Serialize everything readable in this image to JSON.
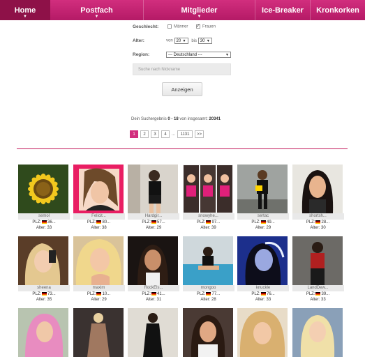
{
  "nav": {
    "items": [
      {
        "label": "Home",
        "caret": "▼"
      },
      {
        "label": "Postfach",
        "caret": "▼"
      },
      {
        "label": "Mitglieder",
        "caret": "▼"
      },
      {
        "label": "Ice-Breaker",
        "caret": ""
      },
      {
        "label": "Kronkorken",
        "caret": ""
      }
    ]
  },
  "filter": {
    "gender_label": "Geschlecht:",
    "male_label": "Männer",
    "male_checked": false,
    "female_label": "Frauen",
    "female_checked": true,
    "age_label": "Alter:",
    "age_from_label": "von",
    "age_from": "20",
    "age_to_label": "bis",
    "age_to": "30",
    "region_label": "Region:",
    "region_value": "--- Deutschland ---",
    "search_placeholder": "Suche nach Nickname",
    "show_button": "Anzeigen"
  },
  "result": {
    "prefix": "Dein Suchergebnis",
    "range": "0 - 18",
    "middle": "von insgesamt:",
    "total": "20341"
  },
  "pagination": {
    "pages": [
      "1",
      "2",
      "3",
      "4"
    ],
    "dots": "...",
    "last": "1131",
    "next": ">>",
    "active": "1"
  },
  "members": [
    {
      "name": "semol",
      "plz": "PLZ:",
      "plz_num": "36...",
      "age": "Alter: 33",
      "photo": "sunflower"
    },
    {
      "name": "Felicit...",
      "plz": "PLZ:",
      "plz_num": "80...",
      "age": "Alter: 38",
      "photo": "pink-frame-woman"
    },
    {
      "name": "Hardgir...",
      "plz": "PLZ:",
      "plz_num": "57...",
      "age": "Alter: 29",
      "photo": "mirror-selfie"
    },
    {
      "name": "snowyhe...",
      "plz": "PLZ:",
      "plz_num": "97...",
      "age": "Alter: 39",
      "photo": "collage"
    },
    {
      "name": "sertac",
      "plz": "PLZ:",
      "plz_num": "49...",
      "age": "Alter: 29",
      "photo": "street-woman"
    },
    {
      "name": "shortsh...",
      "plz": "PLZ:",
      "plz_num": "28...",
      "age": "Alter: 30",
      "photo": "dark-hair-woman"
    },
    {
      "name": "sheena",
      "plz": "PLZ:",
      "plz_num": "73...",
      "age": "Alter: 35",
      "photo": "blonde-selfie"
    },
    {
      "name": "maxim",
      "plz": "PLZ:",
      "plz_num": "10...",
      "age": "Alter: 29",
      "photo": "blonde-curly"
    },
    {
      "name": "RockEls...",
      "plz": "PLZ:",
      "plz_num": "41...",
      "age": "Alter: 31",
      "photo": "dark-portrait"
    },
    {
      "name": "mongoo",
      "plz": "PLZ:",
      "plz_num": "77...",
      "age": "Alter: 28",
      "photo": "pool-woman"
    },
    {
      "name": "knuckle",
      "plz": "PLZ:",
      "plz_num": "76...",
      "age": "Alter: 33",
      "photo": "blue-light-woman"
    },
    {
      "name": "LandDew...",
      "plz": "PLZ:",
      "plz_num": "39...",
      "age": "Alter: 33",
      "photo": "gym-woman"
    },
    {
      "name": "",
      "plz": "",
      "plz_num": "",
      "age": "",
      "photo": "pink-hood"
    },
    {
      "name": "",
      "plz": "",
      "plz_num": "",
      "age": "",
      "photo": "dress-woman"
    },
    {
      "name": "",
      "plz": "",
      "plz_num": "",
      "age": "",
      "photo": "dark-dress"
    },
    {
      "name": "",
      "plz": "",
      "plz_num": "",
      "age": "",
      "photo": "brunette-smile"
    },
    {
      "name": "",
      "plz": "",
      "plz_num": "",
      "age": "",
      "photo": "curly-blonde"
    },
    {
      "name": "",
      "plz": "",
      "plz_num": "",
      "age": "",
      "photo": "blonde-city"
    }
  ],
  "colors": {
    "brand": "#d22e7e",
    "brand_dark": "#8e1148"
  }
}
